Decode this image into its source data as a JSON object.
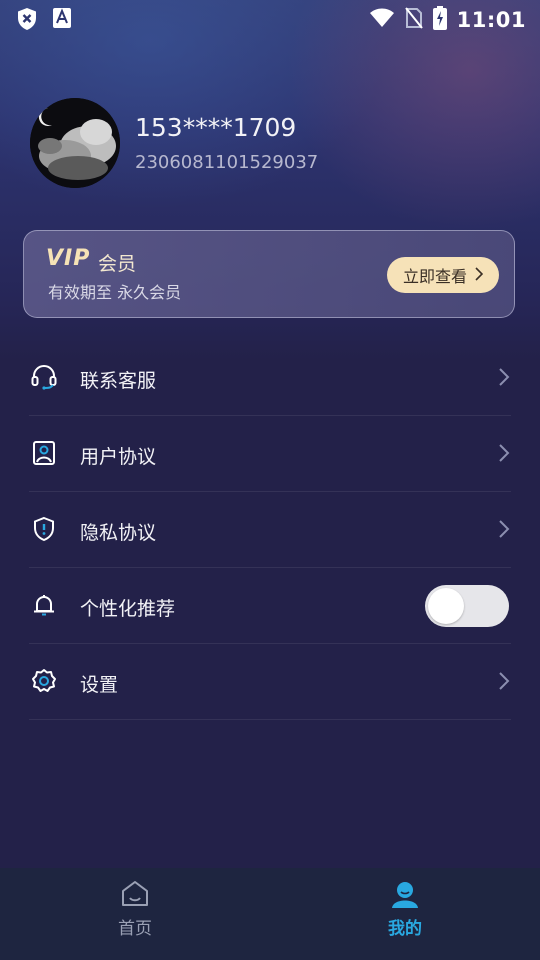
{
  "status_bar": {
    "time": "11:01",
    "left_icons": [
      "shield-x-icon",
      "font-a-icon"
    ],
    "right_icons": [
      "wifi-icon",
      "no-sim-icon",
      "battery-charging-icon"
    ]
  },
  "profile": {
    "phone": "153****1709",
    "user_id": "2306081101529037"
  },
  "vip_card": {
    "logo_text": "VIP",
    "title": "会员",
    "subtitle": "有效期至 永久会员",
    "button_label": "立即查看"
  },
  "menu": {
    "items": [
      {
        "label": "联系客服",
        "icon": "headset-icon",
        "control": "arrow"
      },
      {
        "label": "用户协议",
        "icon": "user-agreement-icon",
        "control": "arrow"
      },
      {
        "label": "隐私协议",
        "icon": "privacy-shield-icon",
        "control": "arrow"
      },
      {
        "label": "个性化推荐",
        "icon": "bell-icon",
        "control": "toggle",
        "toggle_on": false
      },
      {
        "label": "设置",
        "icon": "settings-gear-icon",
        "control": "arrow"
      }
    ]
  },
  "tab_bar": {
    "tabs": [
      {
        "label": "首页",
        "icon": "home-icon",
        "active": false
      },
      {
        "label": "我的",
        "icon": "profile-icon",
        "active": true
      }
    ],
    "active_color": "#29a8e0",
    "inactive_color": "#9aa0b4"
  }
}
